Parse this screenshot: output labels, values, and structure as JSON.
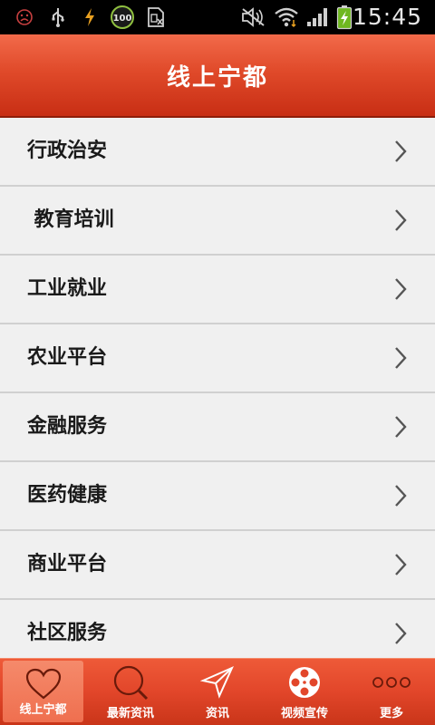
{
  "status_bar": {
    "time": "15:45",
    "battery_badge": "100",
    "icons": [
      "sad-face-icon",
      "usb-icon",
      "flash-icon",
      "battery-100-icon",
      "sim-icon",
      "mute-icon",
      "wifi-icon",
      "signal-icon",
      "battery-charging-icon"
    ]
  },
  "header": {
    "title": "线上宁都"
  },
  "menu": {
    "items": [
      {
        "label": "行政治安"
      },
      {
        "label": " 教育培训"
      },
      {
        "label": "工业就业"
      },
      {
        "label": "农业平台"
      },
      {
        "label": "金融服务"
      },
      {
        "label": "医药健康"
      },
      {
        "label": "商业平台"
      },
      {
        "label": "社区服务"
      }
    ]
  },
  "tabs": [
    {
      "label": "线上宁都",
      "icon": "heart-icon",
      "active": true
    },
    {
      "label": "最新资讯",
      "icon": "search-icon",
      "active": false
    },
    {
      "label": "资讯",
      "icon": "send-icon",
      "active": false
    },
    {
      "label": "视频宣传",
      "icon": "film-reel-icon",
      "active": false
    },
    {
      "label": "更多",
      "icon": "more-dots-icon",
      "active": false
    }
  ],
  "colors": {
    "accent": "#e04a2a",
    "list_bg": "#f0f0f0",
    "divider": "#d0d0d0",
    "text": "#1a1a1a"
  }
}
